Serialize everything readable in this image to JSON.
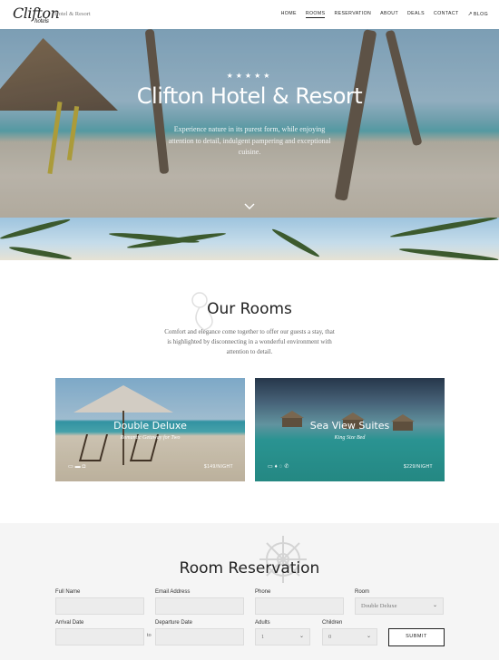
{
  "header": {
    "logo_text": "Clifton",
    "logo_small": "hotels",
    "tagline": "Hotel & Resort",
    "nav": [
      {
        "label": "HOME"
      },
      {
        "label": "ROOMS"
      },
      {
        "label": "RESERVATION"
      },
      {
        "label": "ABOUT"
      },
      {
        "label": "DEALS"
      },
      {
        "label": "CONTACT"
      },
      {
        "label": "BLOG",
        "icon": "external-link-icon"
      }
    ],
    "active_nav": "ROOMS"
  },
  "hero": {
    "stars": "★★★★★",
    "title": "Clifton Hotel & Resort",
    "subtitle": "Experience nature in its purest form, while enjoying attention to detail, indulgent pampering and exceptional cuisine.",
    "scroll_icon": "chevron-down-icon"
  },
  "rooms": {
    "title": "Our Rooms",
    "description": "Comfort and elegance come together to offer our guests a stay, that is highlighted by disconnecting in a wonderful environment with attention to detail.",
    "cards": [
      {
        "title": "Double Deluxe",
        "subtitle": "Romantic Getaway for Two",
        "price": "$149/NIGHT",
        "icons": [
          "tv-icon",
          "bed-icon",
          "bath-icon"
        ]
      },
      {
        "title": "Sea View Suites",
        "subtitle": "King Size Bed",
        "price": "$229/NIGHT",
        "icons": [
          "tv-icon",
          "wine-icon",
          "bath-icon",
          "phone-icon"
        ]
      }
    ]
  },
  "reservation": {
    "title": "Room Reservation",
    "fields": {
      "full_name": {
        "label": "Full Name",
        "value": ""
      },
      "email": {
        "label": "Email Address",
        "value": ""
      },
      "phone": {
        "label": "Phone",
        "value": ""
      },
      "room": {
        "label": "Room",
        "value": "Double Deluxe"
      },
      "arrival": {
        "label": "Arrival Date",
        "value": ""
      },
      "departure": {
        "label": "Departure Date",
        "value": ""
      },
      "adults": {
        "label": "Adults",
        "value": "1"
      },
      "children": {
        "label": "Children",
        "value": "0"
      }
    },
    "to_text": "to",
    "submit_label": "SUBMIT"
  }
}
